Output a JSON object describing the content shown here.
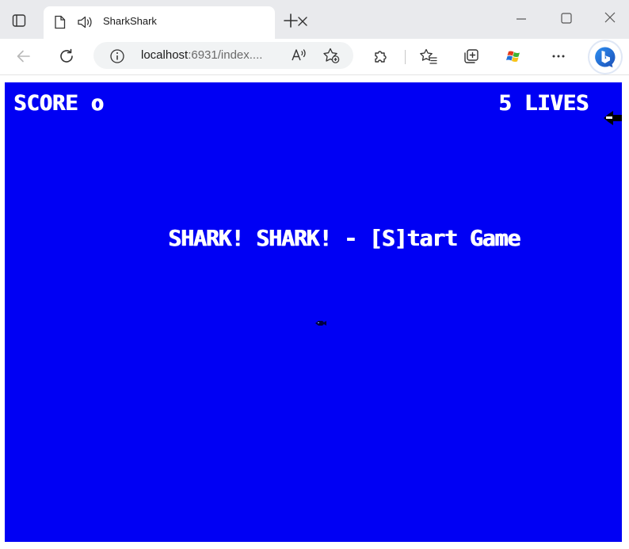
{
  "browser": {
    "tab_title": "SharkShark",
    "url_host": "localhost",
    "url_rest": ":6931/index....",
    "icons": {
      "tab_actions": "tab-actions-icon",
      "page": "page-icon",
      "audio": "speaker-icon",
      "close": "close-icon",
      "new_tab": "plus-icon",
      "back": "arrow-left-icon",
      "refresh": "refresh-icon",
      "info": "info-icon",
      "read_aloud": "read-aloud-icon",
      "add_favorite": "star-add-icon",
      "extensions": "puzzle-icon",
      "favorites": "star-list-icon",
      "collections": "collections-icon",
      "extension_app": "windows-logo-icon",
      "more": "more-icon",
      "bing": "bing-icon"
    }
  },
  "game": {
    "score_label": "SCORE o",
    "lives_label": "5 LIVES",
    "title": "SHARK! SHARK! - [S]tart Game",
    "colors": {
      "background": "#0000f4",
      "text": "#ffffff"
    }
  }
}
